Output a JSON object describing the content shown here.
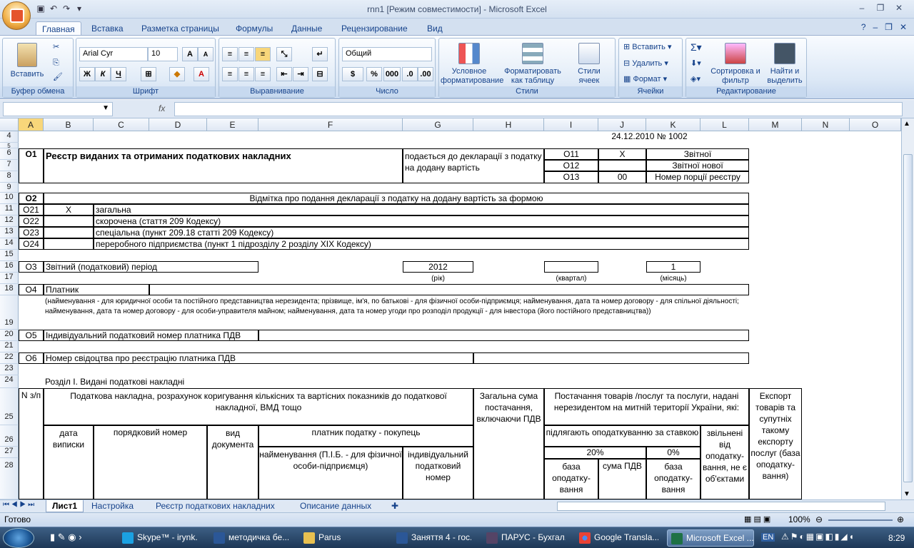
{
  "window": {
    "title": "rnn1  [Режим совместимости] - Microsoft Excel"
  },
  "tabs": [
    "Главная",
    "Вставка",
    "Разметка страницы",
    "Формулы",
    "Данные",
    "Рецензирование",
    "Вид"
  ],
  "ribbon": {
    "clipboard": {
      "label": "Буфер обмена",
      "paste": "Вставить"
    },
    "font": {
      "label": "Шрифт",
      "name": "Arial Cyr",
      "size": "10",
      "bold": "Ж",
      "italic": "К",
      "underline": "Ч"
    },
    "alignment": {
      "label": "Выравнивание"
    },
    "number": {
      "label": "Число",
      "format": "Общий",
      "percent": "%",
      "thousands": "000"
    },
    "styles": {
      "label": "Стили",
      "conditional": "Условное форматирование",
      "astable": "Форматировать как таблицу",
      "cellstyles": "Стили ячеек"
    },
    "cells": {
      "label": "Ячейки",
      "insert": "Вставить",
      "delete": "Удалить",
      "format": "Формат"
    },
    "editing": {
      "label": "Редактирование",
      "sort": "Сортировка и фильтр",
      "find": "Найти и выделить"
    }
  },
  "formula_bar": {
    "fx": "fx",
    "value": ""
  },
  "columns": [
    "A",
    "B",
    "C",
    "D",
    "E",
    "F",
    "G",
    "H",
    "I",
    "J",
    "K",
    "L",
    "M",
    "N",
    "O"
  ],
  "rows": [
    "4",
    "5",
    "6",
    "7",
    "8",
    "9",
    "10",
    "11",
    "12",
    "13",
    "14",
    "15",
    "16",
    "17",
    "18",
    "19",
    "20",
    "21",
    "22",
    "23",
    "24",
    "25",
    "26",
    "27",
    "28"
  ],
  "cells": {
    "k4": "24.12.2010 № 1002",
    "a6": "О1",
    "b6": "Реєстр виданих та отриманих податкових накладних",
    "g6": "подається до декларації з податку на додану вартість",
    "i6": "О11",
    "j6": "X",
    "k6": "Звітної",
    "i7": "О12",
    "k7": "Звітної нової",
    "i8": "О13",
    "j8": "00",
    "k8": "Номер порції реєстру",
    "a10": "О2",
    "b10": "Відмітка про подання декларації з податку на додану вартість за формою",
    "a11": "О21",
    "b11": "X",
    "c11": "загальна",
    "a12": "О22",
    "c12": "скорочена  (стаття 209 Кодексу)",
    "a13": "О23",
    "c13": "спеціальна (пункт 209.18 статті 209 Кодексу)",
    "a14": "О24",
    "c14": "переробного підприємства (пункт 1 підрозділу 2 розділу XIX Кодексу)",
    "a16": "О3",
    "b16": "Звітний (податковий) період",
    "g16": "2012",
    "k16": "1",
    "g17": "(рік)",
    "i17": "(квартал)",
    "k17": "(місяць)",
    "a18": "О4",
    "b18": "Платник",
    "b19": "(найменування - для юридичної особи та постійного представництва нерезидента; прізвище, ім'я, по батькові - для фізичної особи-підприємця; найменування, дата та номер договору - для спільної  діяльності; найменування, дата та номер договору - для особи-управителя майном; найменування, дата та номер угоди про розподіл продукції - для інвестора (його постійного представництва))",
    "a20": "О5",
    "b20": "Індивідуальний податковий номер платника ПДВ",
    "a22": "О6",
    "b22": "Номер свідоцтва про реєстрацію платника ПДВ",
    "b24": "Розділ I. Видані податкові накладні",
    "a25": "N з/п",
    "b25": "Податкова накладна, розрахунок коригування кількісних та вартісних показників до податкової накладної, ВМД тощо",
    "h25": "Загальна сума постачання, включаючи ПДВ",
    "i25": "Постачання товарів /послуг та послуги, надані нерезидентом на митній території України, які:",
    "m25": "Експорт товарів та супутніх такому експорту послуг (база оподатку-вання)",
    "b26": "дата виписки",
    "c26": "порядковий номер",
    "e26": "вид документа",
    "f26": "платник податку - покупець",
    "i26": "підлягають оподаткуванню за ставкою",
    "l26": "звільнені від оподатку-вання, не є об'єктами",
    "i27": "20%",
    "k27": "0%",
    "f27": "найменування (П.І.Б. - для фізичної особи-підприємця)",
    "g27": "індивідуальний податковий номер",
    "i28": "база оподатку-вання",
    "j28": "сума ПДВ",
    "k28": "база оподатку-вання"
  },
  "sheet_tabs": [
    "Лист1",
    "Настройка",
    "Реєстр податкових накладних",
    "Описание данных"
  ],
  "status": {
    "ready": "Готово",
    "zoom": "100%"
  },
  "taskbar": {
    "items": [
      "Skype™ - irynk...",
      "методичка бе...",
      "Parus",
      "Заняття 4 - гос...",
      "ПАРУС - Бухгал...",
      "Google Transla...",
      "Microsoft Excel ..."
    ],
    "lang": "EN",
    "time": "8:29"
  }
}
